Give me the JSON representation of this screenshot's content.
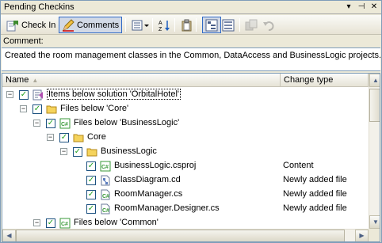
{
  "window": {
    "title": "Pending Checkins",
    "dropdown_glyph": "▾",
    "pin_glyph": "⊣",
    "close_glyph": "✕"
  },
  "toolbar": {
    "checkin_label": "Check In",
    "comments_label": "Comments"
  },
  "comment": {
    "label": "Comment:",
    "text": "Created the room management classes in the Common, DataAccess and BusinessLogic projects."
  },
  "list": {
    "col_name": "Name",
    "col_change": "Change type",
    "sort_glyph": "▲"
  },
  "tree": [
    {
      "label": "Items below solution 'OrbitalHotel'",
      "change": "",
      "icon": "solution-icon",
      "expander": "-",
      "checked": true
    },
    {
      "label": "Files below 'Core'",
      "change": "",
      "icon": "folder-icon",
      "expander": "-",
      "checked": true
    },
    {
      "label": "Files below 'BusinessLogic'",
      "change": "",
      "icon": "csharp-project-icon",
      "expander": "-",
      "checked": true
    },
    {
      "label": "Core",
      "change": "",
      "icon": "folder-icon",
      "expander": "-",
      "checked": true
    },
    {
      "label": "BusinessLogic",
      "change": "",
      "icon": "folder-icon",
      "expander": "-",
      "checked": true
    },
    {
      "label": "BusinessLogic.csproj",
      "change": "Content",
      "icon": "csharp-project-icon",
      "expander": "",
      "checked": true
    },
    {
      "label": "ClassDiagram.cd",
      "change": "Newly added file",
      "icon": "class-diagram-icon",
      "expander": "",
      "checked": true
    },
    {
      "label": "RoomManager.cs",
      "change": "Newly added file",
      "icon": "csharp-file-icon",
      "expander": "",
      "checked": true
    },
    {
      "label": "RoomManager.Designer.cs",
      "change": "Newly added file",
      "icon": "csharp-file-icon",
      "expander": "",
      "checked": true
    },
    {
      "label": "Files below 'Common'",
      "change": "",
      "icon": "csharp-project-icon",
      "expander": "-",
      "checked": true
    }
  ],
  "checkmark_glyph": "✓",
  "colors": {
    "selection_border": "#316ac5",
    "check_green": "#21a121",
    "folder_yellow": "#f5d35c",
    "csharp_green": "#3a9a3a"
  }
}
